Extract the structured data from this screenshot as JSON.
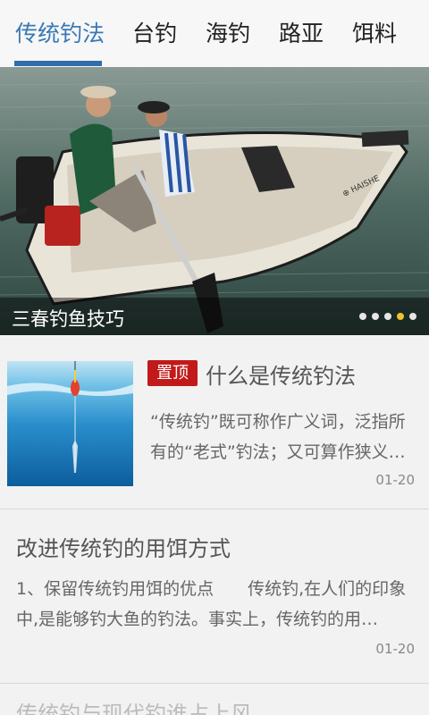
{
  "tabs": [
    {
      "label": "传统钓法",
      "active": true
    },
    {
      "label": "台钓",
      "active": false
    },
    {
      "label": "海钓",
      "active": false
    },
    {
      "label": "路亚",
      "active": false
    },
    {
      "label": "饵料",
      "active": false
    }
  ],
  "banner": {
    "title": "三春钓鱼技巧",
    "slides_total": 5,
    "active_slide": 4
  },
  "articles": [
    {
      "badge": "置顶",
      "title": "什么是传统钓法",
      "summary": "“传统钓”既可称作广义词，泛指所有的“老式”钓法；又可算作狭义…",
      "date": "01-20"
    },
    {
      "title": "改进传统钓的用饵方式",
      "summary": "1、保留传统钓用饵的优点　　传统钓,在人们的印象中,是能够钓大鱼的钓法。事实上，传统钓的用…",
      "date": "01-20"
    },
    {
      "title": "传统钓与现代钓谁占上风"
    }
  ],
  "colors": {
    "accent": "#2f6ea8",
    "badge": "#c21a1a",
    "dot_active": "#f2c12e"
  }
}
